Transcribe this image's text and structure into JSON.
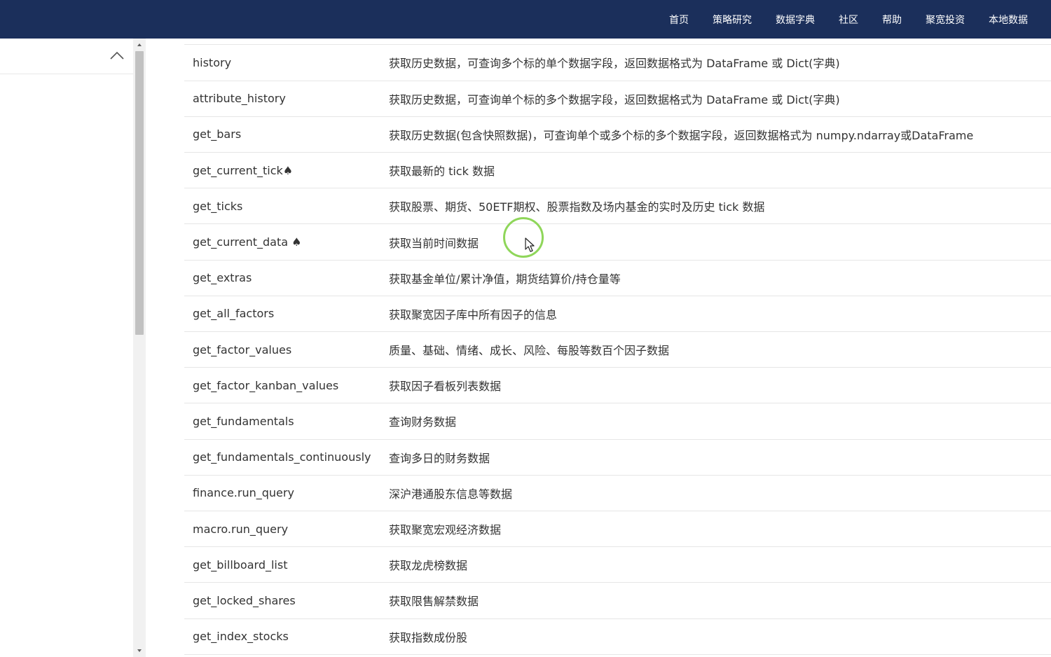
{
  "nav": {
    "items": [
      "首页",
      "策略研究",
      "数据字典",
      "社区",
      "帮助",
      "聚宽投资",
      "本地数据"
    ]
  },
  "rows": [
    {
      "name": "history",
      "desc": "获取历史数据，可查询多个标的单个数据字段，返回数据格式为 DataFrame 或 Dict(字典)"
    },
    {
      "name": "attribute_history",
      "desc": "获取历史数据，可查询单个标的多个数据字段，返回数据格式为 DataFrame 或 Dict(字典)"
    },
    {
      "name": "get_bars",
      "desc": "获取历史数据(包含快照数据)，可查询单个或多个标的多个数据字段，返回数据格式为 numpy.ndarray或DataFrame"
    },
    {
      "name": "get_current_tick♠",
      "desc": "获取最新的 tick 数据"
    },
    {
      "name": "get_ticks",
      "desc": "获取股票、期货、50ETF期权、股票指数及场内基金的实时及历史 tick 数据"
    },
    {
      "name": "get_current_data ♠",
      "desc": "获取当前时间数据"
    },
    {
      "name": "get_extras",
      "desc": "获取基金单位/累计净值，期货结算价/持仓量等"
    },
    {
      "name": "get_all_factors",
      "desc": "获取聚宽因子库中所有因子的信息"
    },
    {
      "name": "get_factor_values",
      "desc": "质量、基础、情绪、成长、风险、每股等数百个因子数据"
    },
    {
      "name": "get_factor_kanban_values",
      "desc": "获取因子看板列表数据"
    },
    {
      "name": "get_fundamentals",
      "desc": "查询财务数据"
    },
    {
      "name": "get_fundamentals_continuously",
      "desc": "查询多日的财务数据"
    },
    {
      "name": "finance.run_query",
      "desc": "深沪港通股东信息等数据"
    },
    {
      "name": "macro.run_query",
      "desc": "获取聚宽宏观经济数据"
    },
    {
      "name": "get_billboard_list",
      "desc": "获取龙虎榜数据"
    },
    {
      "name": "get_locked_shares",
      "desc": "获取限售解禁数据"
    },
    {
      "name": "get_index_stocks",
      "desc": "获取指数成份股"
    }
  ],
  "colors": {
    "topbar": "#1b2f5b",
    "nav_text": "#ffffff",
    "cursor_ring": "#8fd65a"
  },
  "icons": {
    "sidebar_toggle": "chevron-up-icon",
    "cursor": "mouse-pointer-icon"
  }
}
